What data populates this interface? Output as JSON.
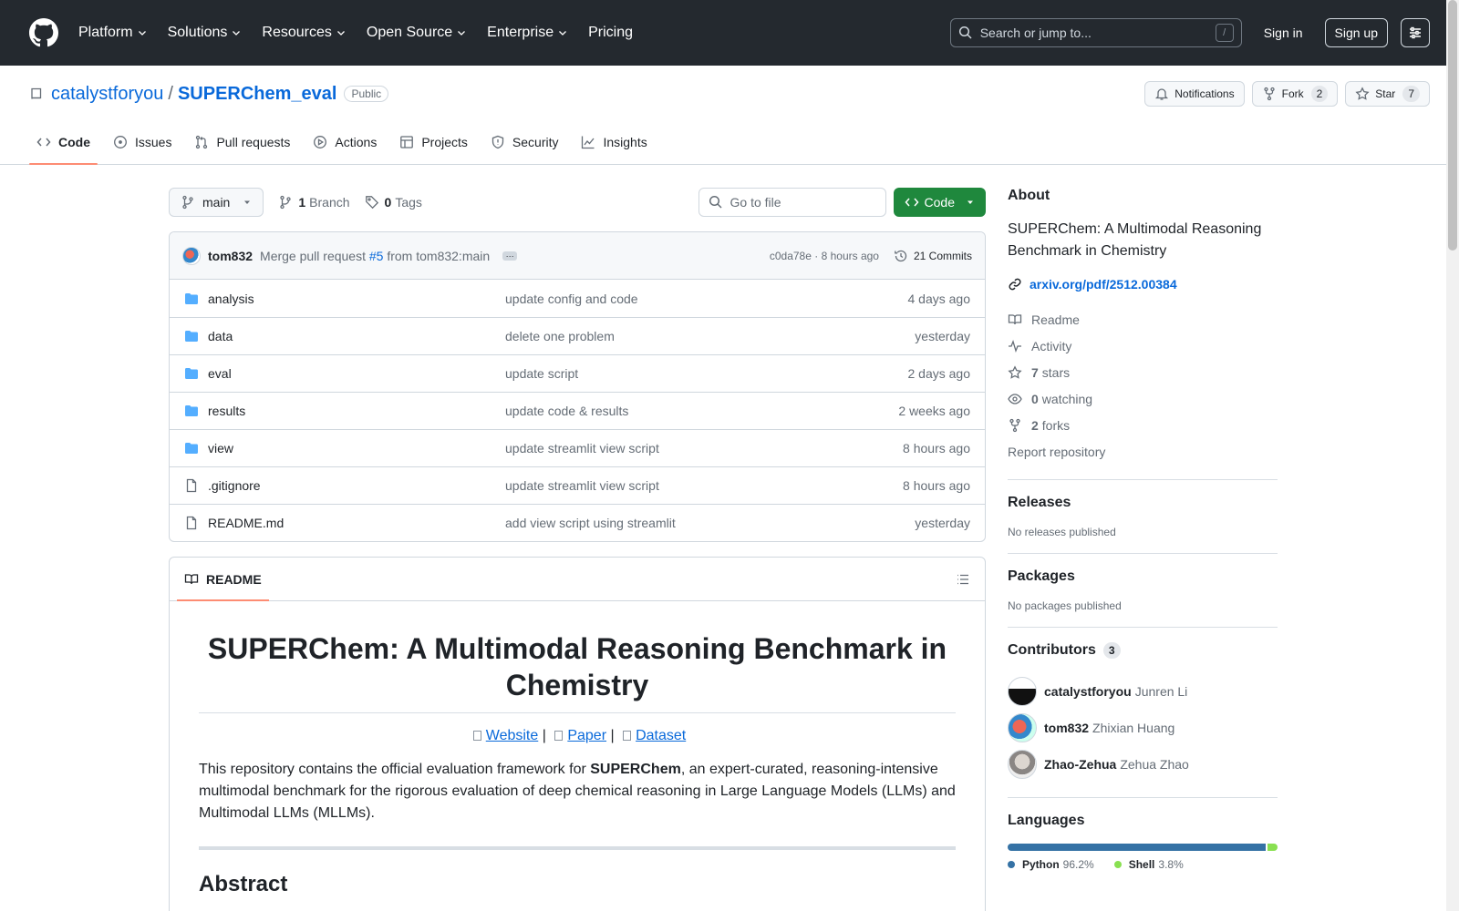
{
  "header": {
    "nav": [
      "Platform",
      "Solutions",
      "Resources",
      "Open Source",
      "Enterprise",
      "Pricing"
    ],
    "search_placeholder": "Search or jump to...",
    "slash_key": "/",
    "signin": "Sign in",
    "signup": "Sign up"
  },
  "repo": {
    "owner": "catalystforyou",
    "separator": "/",
    "name": "SUPERChem_eval",
    "visibility": "Public",
    "notifications": "Notifications",
    "fork_label": "Fork",
    "fork_count": "2",
    "star_label": "Star",
    "star_count": "7"
  },
  "tabs": [
    {
      "label": "Code",
      "icon": "code-icon"
    },
    {
      "label": "Issues",
      "icon": "issue-icon"
    },
    {
      "label": "Pull requests",
      "icon": "pull-request-icon"
    },
    {
      "label": "Actions",
      "icon": "play-icon"
    },
    {
      "label": "Projects",
      "icon": "table-icon"
    },
    {
      "label": "Security",
      "icon": "shield-icon"
    },
    {
      "label": "Insights",
      "icon": "graph-icon"
    }
  ],
  "filebar": {
    "branch": "main",
    "branch_count": "1",
    "branch_label": "Branch",
    "tag_count": "0",
    "tag_label": "Tags",
    "goto_placeholder": "Go to file",
    "code_button": "Code"
  },
  "commit": {
    "author": "tom832",
    "message_prefix": "Merge pull request",
    "pr": "#5",
    "message_suffix": "from tom832:main",
    "hash": "c0da78e",
    "dot": "·",
    "time": "8 hours ago",
    "commits": "21 Commits"
  },
  "files": [
    {
      "name": "analysis",
      "type": "dir",
      "message": "update config and code",
      "time": "4 days ago"
    },
    {
      "name": "data",
      "type": "dir",
      "message": "delete one problem",
      "time": "yesterday"
    },
    {
      "name": "eval",
      "type": "dir",
      "message": "update script",
      "time": "2 days ago"
    },
    {
      "name": "results",
      "type": "dir",
      "message": "update code & results",
      "time": "2 weeks ago"
    },
    {
      "name": "view",
      "type": "dir",
      "message": "update streamlit view script",
      "time": "8 hours ago"
    },
    {
      "name": ".gitignore",
      "type": "file",
      "message": "update streamlit view script",
      "time": "8 hours ago"
    },
    {
      "name": "README.md",
      "type": "file",
      "message": "add view script using streamlit",
      "time": "yesterday"
    }
  ],
  "readme": {
    "tab": "README",
    "title": "SUPERChem: A Multimodal Reasoning Benchmark in Chemistry",
    "link_website": "Website",
    "link_paper": "Paper",
    "link_dataset": "Dataset",
    "link_sep": "|",
    "para_prefix": "This repository contains the official evaluation framework for ",
    "para_bold": "SUPERChem",
    "para_suffix": ", an expert-curated, reasoning-intensive multimodal benchmark for the rigorous evaluation of deep chemical reasoning in Large Language Models (LLMs) and Multimodal LLMs (MLLMs).",
    "h2": "Abstract"
  },
  "about": {
    "heading": "About",
    "description": "SUPERChem: A Multimodal Reasoning Benchmark in Chemistry",
    "link": "arxiv.org/pdf/2512.00384",
    "readme": "Readme",
    "activity": "Activity",
    "stars_count": "7",
    "stars_label": "stars",
    "watching_count": "0",
    "watching_label": "watching",
    "forks_count": "2",
    "forks_label": "forks",
    "report": "Report repository"
  },
  "releases": {
    "heading": "Releases",
    "text": "No releases published"
  },
  "packages": {
    "heading": "Packages",
    "text": "No packages published"
  },
  "contributors": {
    "heading": "Contributors",
    "count": "3",
    "list": [
      {
        "login": "catalystforyou",
        "name": "Junren Li"
      },
      {
        "login": "tom832",
        "name": "Zhixian Huang"
      },
      {
        "login": "Zhao-Zehua",
        "name": "Zehua Zhao"
      }
    ]
  },
  "languages": {
    "heading": "Languages",
    "list": [
      {
        "name": "Python",
        "percent": "96.2%",
        "value": 96.2,
        "color": "#3572A5"
      },
      {
        "name": "Shell",
        "percent": "3.8%",
        "value": 3.8,
        "color": "#89e051"
      }
    ]
  }
}
